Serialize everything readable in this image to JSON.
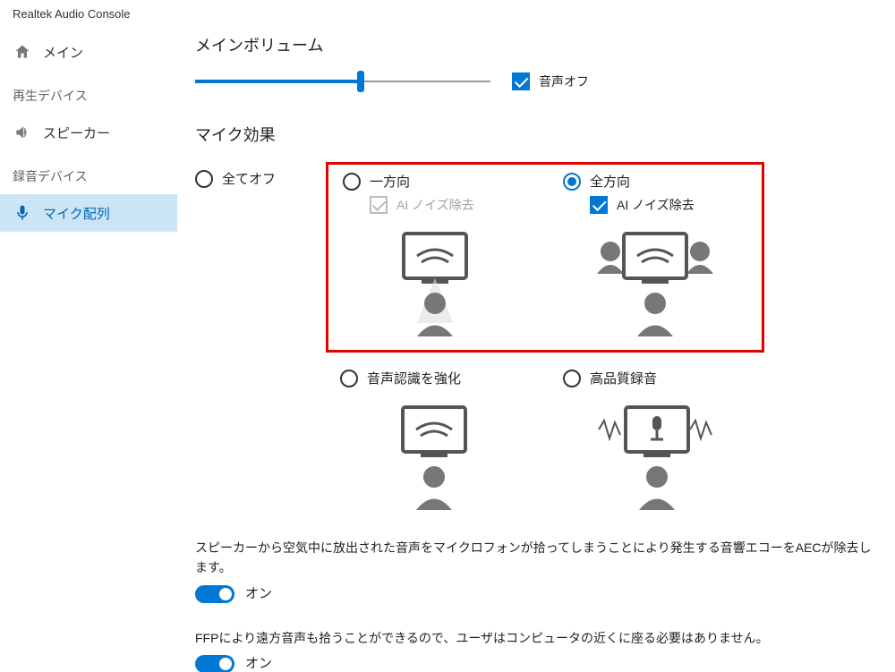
{
  "app_title": "Realtek Audio Console",
  "sidebar": {
    "main_label": "メイン",
    "playback_header": "再生デバイス",
    "speaker_label": "スピーカー",
    "record_header": "録音デバイス",
    "mic_array_label": "マイク配列"
  },
  "main_volume": {
    "heading": "メインボリューム",
    "value_percent": 56,
    "mute_label": "音声オフ",
    "mute_checked": true
  },
  "mic_effects": {
    "heading": "マイク効果",
    "all_off_label": "全てオフ",
    "one_way": {
      "label": "一方向",
      "ai_noise_label": "AI ノイズ除去",
      "ai_noise_checked": true,
      "ai_noise_disabled": true
    },
    "omni": {
      "label": "全方向",
      "ai_noise_label": "AI ノイズ除去",
      "ai_noise_checked": true,
      "selected": true
    },
    "voice_recog_label": "音声認識を強化",
    "high_quality_label": "高品質録音"
  },
  "aec": {
    "desc": "スピーカーから空気中に放出された音声をマイクロフォンが拾ってしまうことにより発生する音響エコーをAECが除去します。",
    "state_label": "オン"
  },
  "ffp": {
    "desc": "FFPにより遠方音声も拾うことができるので、ユーザはコンピュータの近くに座る必要はありません。",
    "state_label": "オン"
  }
}
